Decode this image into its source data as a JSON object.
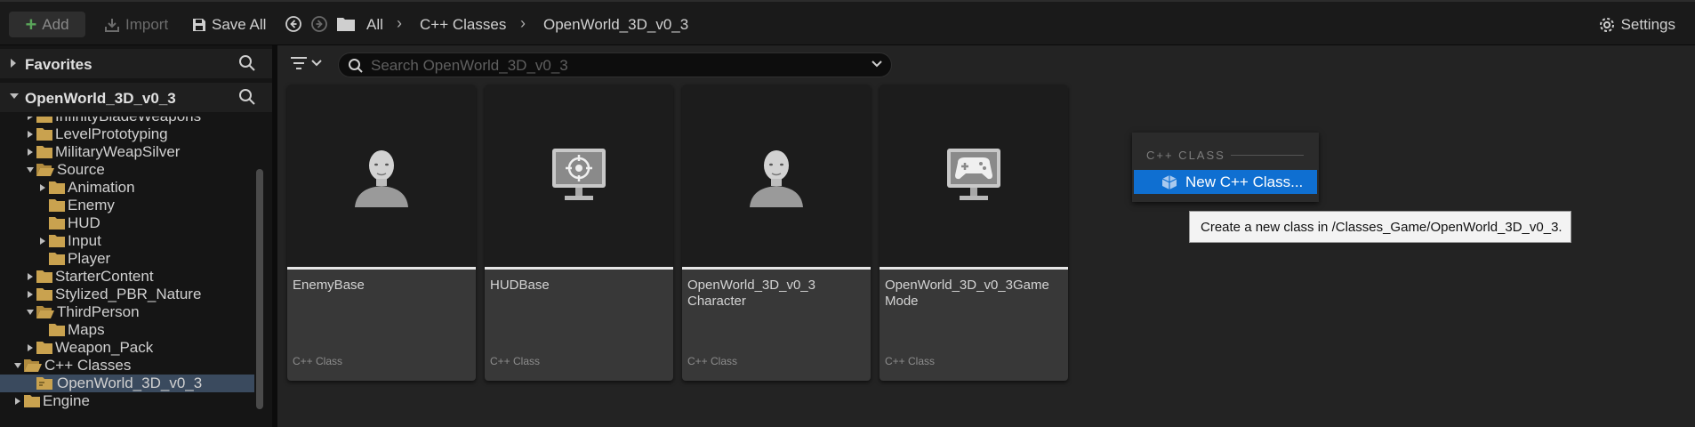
{
  "toolbar": {
    "add_label": "Add",
    "import_label": "Import",
    "saveall_label": "Save All",
    "breadcrumb": [
      "All",
      "C++ Classes",
      "OpenWorld_3D_v0_3"
    ],
    "settings_label": "Settings"
  },
  "left_panel": {
    "favorites_label": "Favorites",
    "project_label": "OpenWorld_3D_v0_3",
    "tree": [
      {
        "label": "InfinityBladeWeapons",
        "depth": 1,
        "expander": "collapsed",
        "folder": "closed"
      },
      {
        "label": "LevelPrototyping",
        "depth": 1,
        "expander": "collapsed",
        "folder": "closed"
      },
      {
        "label": "MilitaryWeapSilver",
        "depth": 1,
        "expander": "collapsed",
        "folder": "closed"
      },
      {
        "label": "Source",
        "depth": 1,
        "expander": "expanded",
        "folder": "open"
      },
      {
        "label": "Animation",
        "depth": 2,
        "expander": "collapsed",
        "folder": "closed"
      },
      {
        "label": "Enemy",
        "depth": 2,
        "expander": "none",
        "folder": "closed"
      },
      {
        "label": "HUD",
        "depth": 2,
        "expander": "none",
        "folder": "closed"
      },
      {
        "label": "Input",
        "depth": 2,
        "expander": "collapsed",
        "folder": "closed"
      },
      {
        "label": "Player",
        "depth": 2,
        "expander": "none",
        "folder": "closed"
      },
      {
        "label": "StarterContent",
        "depth": 1,
        "expander": "collapsed",
        "folder": "closed"
      },
      {
        "label": "Stylized_PBR_Nature",
        "depth": 1,
        "expander": "collapsed",
        "folder": "closed"
      },
      {
        "label": "ThirdPerson",
        "depth": 1,
        "expander": "expanded",
        "folder": "open"
      },
      {
        "label": "Maps",
        "depth": 2,
        "expander": "none",
        "folder": "closed"
      },
      {
        "label": "Weapon_Pack",
        "depth": 1,
        "expander": "collapsed",
        "folder": "closed"
      },
      {
        "label": "C++ Classes",
        "depth": 0,
        "expander": "expanded",
        "folder": "open"
      },
      {
        "label": "OpenWorld_3D_v0_3",
        "depth": 1,
        "expander": "none",
        "folder": "cpp",
        "selected": true
      },
      {
        "label": "Engine",
        "depth": 0,
        "expander": "collapsed",
        "folder": "closed"
      }
    ]
  },
  "search": {
    "placeholder": "Search OpenWorld_3D_v0_3",
    "value": ""
  },
  "assets": [
    {
      "name": "EnemyBase",
      "type": "C++ Class",
      "icon": "character-icon"
    },
    {
      "name": "HUDBase",
      "type": "C++ Class",
      "icon": "hud-icon"
    },
    {
      "name": "OpenWorld_3D_v0_3 Character",
      "type": "C++ Class",
      "icon": "character-icon"
    },
    {
      "name": "OpenWorld_3D_v0_3Game Mode",
      "type": "C++ Class",
      "icon": "gamemode-icon"
    }
  ],
  "context_menu": {
    "header": "C++ CLASS",
    "item_label": "New C++ Class...",
    "tooltip": "Create a new class in /Classes_Game/OpenWorld_3D_v0_3."
  },
  "colors": {
    "folder": "#c9a24f",
    "accent": "#0f6fd1",
    "selected_row": "#3a4a5e",
    "add_plus": "#5aa55a"
  }
}
